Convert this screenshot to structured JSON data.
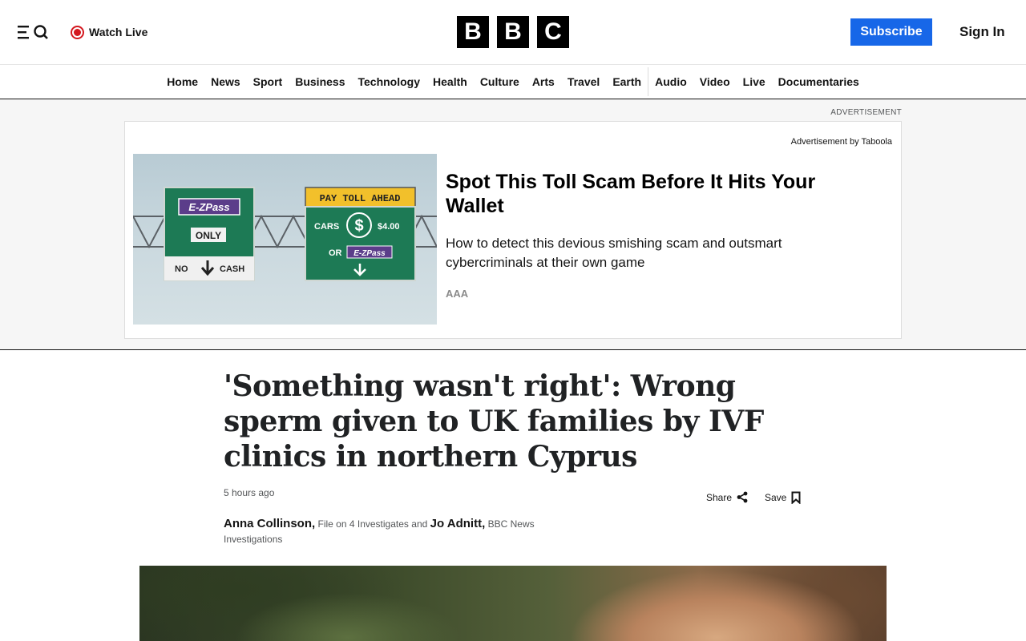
{
  "header": {
    "watch_live": "Watch Live",
    "logo": [
      "B",
      "B",
      "C"
    ],
    "subscribe": "Subscribe",
    "sign_in": "Sign In",
    "menu_icon": "menu-search-icon",
    "live_icon": "live-dot-icon",
    "accent_color": "#1767e8",
    "live_color": "#d4181f"
  },
  "nav": {
    "items": [
      "Home",
      "News",
      "Sport",
      "Business",
      "Technology",
      "Health",
      "Culture",
      "Arts",
      "Travel",
      "Earth",
      "Audio",
      "Video",
      "Live",
      "Documentaries"
    ]
  },
  "ad": {
    "label": "ADVERTISEMENT",
    "provider": "Advertisement by Taboola",
    "headline": "Spot This Toll Scam Before It Hits Your Wallet",
    "description": "How to detect this devious smishing scam and outsmart cybercriminals at their own game",
    "source": "AAA",
    "image": {
      "sign1_top": "E-ZPass",
      "sign1_mid": "ONLY",
      "sign1_no": "NO",
      "sign1_cash": "CASH",
      "sign2_header": "PAY TOLL AHEAD",
      "sign2_cars": "CARS",
      "sign2_price": "$4.00",
      "sign2_or": "OR",
      "sign2_ezpass": "E-ZPass"
    }
  },
  "article": {
    "headline": "'Something wasn't right': Wrong sperm given to UK families by IVF clinics in northern Cyprus",
    "timestamp": "5 hours ago",
    "share": "Share",
    "save": "Save",
    "authors": [
      {
        "name": "Anna Collinson,",
        "role": "File on 4 Investigates"
      },
      {
        "name": "Jo Adnitt,",
        "role": "BBC News Investigations"
      }
    ],
    "byline_and": "and"
  }
}
